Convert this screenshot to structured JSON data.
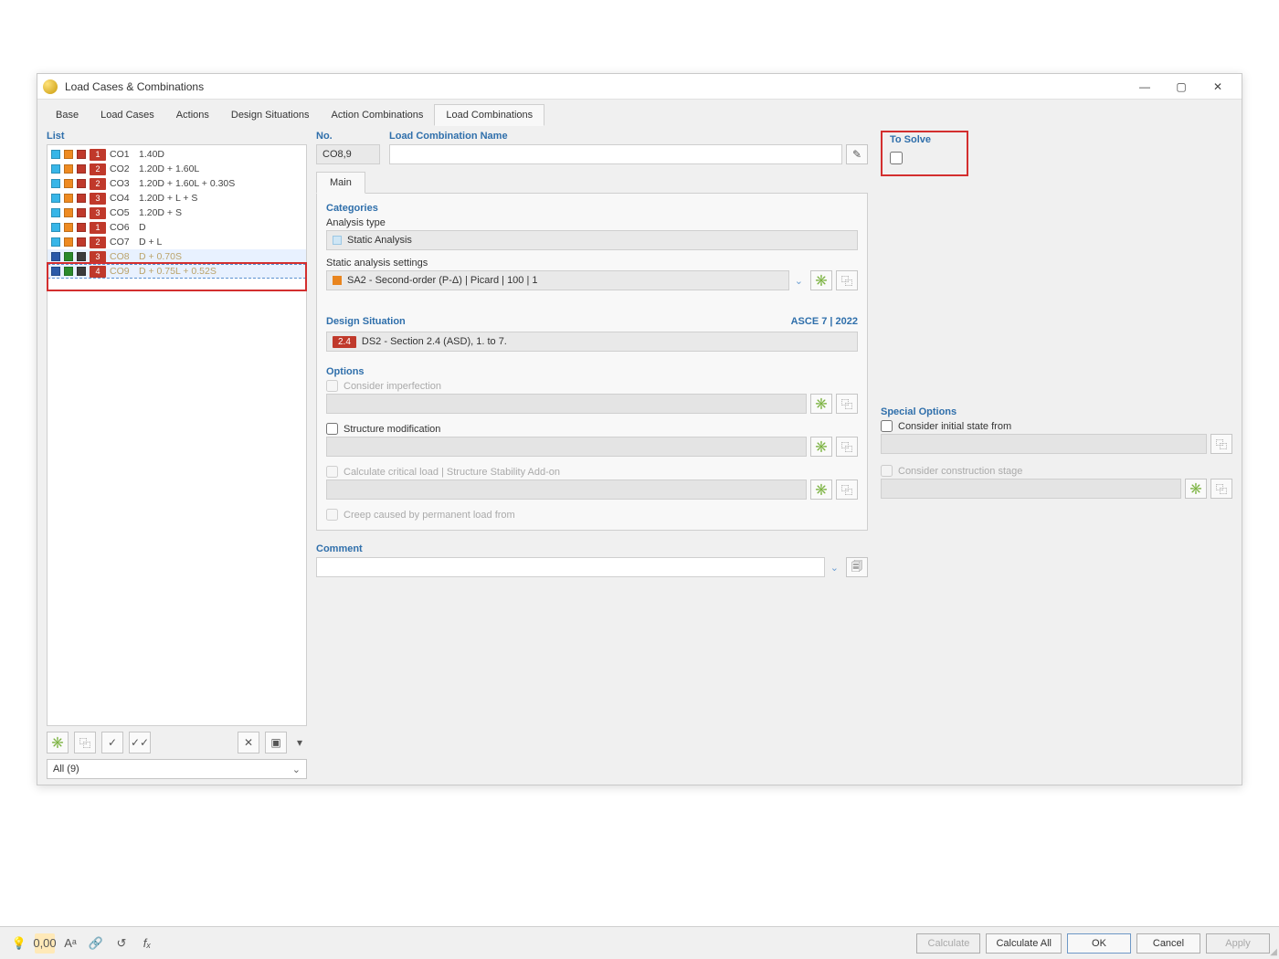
{
  "window": {
    "title": "Load Cases & Combinations"
  },
  "tabs": [
    "Base",
    "Load Cases",
    "Actions",
    "Design Situations",
    "Action Combinations",
    "Load Combinations"
  ],
  "tabs_active_index": 5,
  "left": {
    "list_label": "List",
    "rows": [
      {
        "badge": "1",
        "code": "CO1",
        "txt": "1.40D",
        "sq": [
          "cy",
          "or",
          "rd"
        ],
        "dim": false
      },
      {
        "badge": "2",
        "code": "CO2",
        "txt": "1.20D + 1.60L",
        "sq": [
          "cy",
          "or",
          "rd"
        ],
        "dim": false
      },
      {
        "badge": "2",
        "code": "CO3",
        "txt": "1.20D + 1.60L + 0.30S",
        "sq": [
          "cy",
          "or",
          "rd"
        ],
        "dim": false
      },
      {
        "badge": "3",
        "code": "CO4",
        "txt": "1.20D + L + S",
        "sq": [
          "cy",
          "or",
          "rd"
        ],
        "dim": false
      },
      {
        "badge": "3",
        "code": "CO5",
        "txt": "1.20D + S",
        "sq": [
          "cy",
          "or",
          "rd"
        ],
        "dim": false
      },
      {
        "badge": "1",
        "code": "CO6",
        "txt": "D",
        "sq": [
          "cy",
          "or",
          "rd"
        ],
        "dim": false
      },
      {
        "badge": "2",
        "code": "CO7",
        "txt": "D + L",
        "sq": [
          "cy",
          "or",
          "rd"
        ],
        "dim": false
      },
      {
        "badge": "3",
        "code": "CO8",
        "txt": "D + 0.70S",
        "sq": [
          "bl",
          "gr",
          "dgr"
        ],
        "dim": true
      },
      {
        "badge": "4",
        "code": "CO9",
        "txt": "D + 0.75L + 0.52S",
        "sq": [
          "bl",
          "gr",
          "dgr"
        ],
        "dim": true
      }
    ],
    "filter": "All (9)"
  },
  "mid": {
    "no_label": "No.",
    "no_value": "CO8,9",
    "name_label": "Load Combination Name",
    "name_value": "",
    "main_tab": "Main",
    "categories_label": "Categories",
    "analysis_type_label": "Analysis type",
    "analysis_type_value": "Static Analysis",
    "static_settings_label": "Static analysis settings",
    "static_settings_value": "SA2 - Second-order (P-Δ) | Picard | 100 | 1",
    "design_situation_label": "Design Situation",
    "design_standard": "ASCE 7 | 2022",
    "design_badge": "2.4",
    "design_value": "DS2 - Section 2.4 (ASD), 1. to 7.",
    "options_label": "Options",
    "opt_imperfection": "Consider imperfection",
    "opt_structure_mod": "Structure modification",
    "opt_critical": "Calculate critical load | Structure Stability Add-on",
    "opt_creep": "Creep caused by permanent load from",
    "comment_label": "Comment"
  },
  "right": {
    "tosolve_label": "To Solve",
    "special_options_label": "Special Options",
    "opt_initial_state": "Consider initial state from",
    "opt_construction_stage": "Consider construction stage"
  },
  "footer": {
    "calculate": "Calculate",
    "calculate_all": "Calculate All",
    "ok": "OK",
    "cancel": "Cancel",
    "apply": "Apply"
  }
}
